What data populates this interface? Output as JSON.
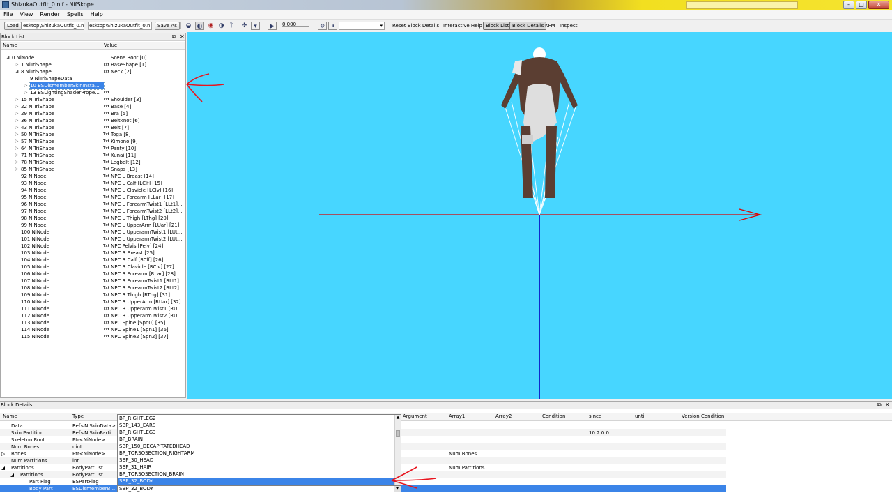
{
  "window": {
    "title": "ShizukaOutfit_0.nif - NifSkope",
    "min": "–",
    "max": "□",
    "close": "✕"
  },
  "menu": [
    "File",
    "View",
    "Render",
    "Spells",
    "Help"
  ],
  "toolbar": {
    "load": "Load",
    "load_path": "esktop\\ShizukaOutfit_0.nif",
    "save_path": "esktop\\ShizukaOutfit_0.nif",
    "save_as": "Save As",
    "time_value": "0.000",
    "reset_block_details": "Reset Block Details",
    "interactive_help": "Interactive Help",
    "block_list": "Block List",
    "block_details": "Block Details",
    "kfm": "KFM",
    "inspect": "Inspect"
  },
  "block_list": {
    "title": "Block List",
    "col_name": "Name",
    "col_value": "Value",
    "rows": [
      {
        "tw": "◢",
        "name": "0 NiNode",
        "txt": "",
        "value": "Scene Root [0]",
        "d": 0
      },
      {
        "tw": "▷",
        "name": "1 NiTriShape",
        "txt": "Txt",
        "value": "BaseShape [1]",
        "d": 1
      },
      {
        "tw": "◢",
        "name": "8 NiTriShape",
        "txt": "Txt",
        "value": "Neck [2]",
        "d": 1
      },
      {
        "tw": "",
        "name": "9 NiTriShapeData",
        "txt": "",
        "value": "",
        "d": 2
      },
      {
        "tw": "▷",
        "name": "10 BSDismemberSkinInsta...",
        "txt": "",
        "value": "",
        "d": 2,
        "sel": true
      },
      {
        "tw": "▷",
        "name": "13 BSLightingShaderPrope...",
        "txt": "Txt",
        "value": "",
        "d": 2
      },
      {
        "tw": "▷",
        "name": "15 NiTriShape",
        "txt": "Txt",
        "value": "Shoulder [3]",
        "d": 1
      },
      {
        "tw": "▷",
        "name": "22 NiTriShape",
        "txt": "Txt",
        "value": "Base [4]",
        "d": 1
      },
      {
        "tw": "▷",
        "name": "29 NiTriShape",
        "txt": "Txt",
        "value": "Bra [5]",
        "d": 1
      },
      {
        "tw": "▷",
        "name": "36 NiTriShape",
        "txt": "Txt",
        "value": "Beltknot [6]",
        "d": 1
      },
      {
        "tw": "▷",
        "name": "43 NiTriShape",
        "txt": "Txt",
        "value": "Belt [7]",
        "d": 1
      },
      {
        "tw": "▷",
        "name": "50 NiTriShape",
        "txt": "Txt",
        "value": "Toga [8]",
        "d": 1
      },
      {
        "tw": "▷",
        "name": "57 NiTriShape",
        "txt": "Txt",
        "value": "Kimono [9]",
        "d": 1
      },
      {
        "tw": "▷",
        "name": "64 NiTriShape",
        "txt": "Txt",
        "value": "Panty [10]",
        "d": 1
      },
      {
        "tw": "▷",
        "name": "71 NiTriShape",
        "txt": "Txt",
        "value": "Kunai [11]",
        "d": 1
      },
      {
        "tw": "▷",
        "name": "78 NiTriShape",
        "txt": "Txt",
        "value": "Legbelt [12]",
        "d": 1
      },
      {
        "tw": "▷",
        "name": "85 NiTriShape",
        "txt": "Txt",
        "value": "Snaps [13]",
        "d": 1
      },
      {
        "tw": "",
        "name": "92 NiNode",
        "txt": "Txt",
        "value": "NPC L Breast [14]",
        "d": 1
      },
      {
        "tw": "",
        "name": "93 NiNode",
        "txt": "Txt",
        "value": "NPC L Calf [LClf] [15]",
        "d": 1
      },
      {
        "tw": "",
        "name": "94 NiNode",
        "txt": "Txt",
        "value": "NPC L Clavicle [LClv] [16]",
        "d": 1
      },
      {
        "tw": "",
        "name": "95 NiNode",
        "txt": "Txt",
        "value": "NPC L Forearm [LLar] [17]",
        "d": 1
      },
      {
        "tw": "",
        "name": "96 NiNode",
        "txt": "Txt",
        "value": "NPC L ForearmTwist1 [LLt1]...",
        "d": 1
      },
      {
        "tw": "",
        "name": "97 NiNode",
        "txt": "Txt",
        "value": "NPC L ForearmTwist2 [LLt2]...",
        "d": 1
      },
      {
        "tw": "",
        "name": "98 NiNode",
        "txt": "Txt",
        "value": "NPC L Thigh [LThg] [20]",
        "d": 1
      },
      {
        "tw": "",
        "name": "99 NiNode",
        "txt": "Txt",
        "value": "NPC L UpperArm [LUar] [21]",
        "d": 1
      },
      {
        "tw": "",
        "name": "100 NiNode",
        "txt": "Txt",
        "value": "NPC L UpperarmTwist1 [LUt...",
        "d": 1
      },
      {
        "tw": "",
        "name": "101 NiNode",
        "txt": "Txt",
        "value": "NPC L UpperarmTwist2 [LUt...",
        "d": 1
      },
      {
        "tw": "",
        "name": "102 NiNode",
        "txt": "Txt",
        "value": "NPC Pelvis [Pelv] [24]",
        "d": 1
      },
      {
        "tw": "",
        "name": "103 NiNode",
        "txt": "Txt",
        "value": "NPC R Breast [25]",
        "d": 1
      },
      {
        "tw": "",
        "name": "104 NiNode",
        "txt": "Txt",
        "value": "NPC R Calf [RClf] [26]",
        "d": 1
      },
      {
        "tw": "",
        "name": "105 NiNode",
        "txt": "Txt",
        "value": "NPC R Clavicle [RClv] [27]",
        "d": 1
      },
      {
        "tw": "",
        "name": "106 NiNode",
        "txt": "Txt",
        "value": "NPC R Forearm [RLar] [28]",
        "d": 1
      },
      {
        "tw": "",
        "name": "107 NiNode",
        "txt": "Txt",
        "value": "NPC R ForearmTwist1 [RLt1]...",
        "d": 1
      },
      {
        "tw": "",
        "name": "108 NiNode",
        "txt": "Txt",
        "value": "NPC R ForearmTwist2 [RLt2]...",
        "d": 1
      },
      {
        "tw": "",
        "name": "109 NiNode",
        "txt": "Txt",
        "value": "NPC R Thigh [RThg] [31]",
        "d": 1
      },
      {
        "tw": "",
        "name": "110 NiNode",
        "txt": "Txt",
        "value": "NPC R UpperArm [RUar] [32]",
        "d": 1
      },
      {
        "tw": "",
        "name": "111 NiNode",
        "txt": "Txt",
        "value": "NPC R UpperarmTwist1 [RU...",
        "d": 1
      },
      {
        "tw": "",
        "name": "112 NiNode",
        "txt": "Txt",
        "value": "NPC R UpperarmTwist2 [RU...",
        "d": 1
      },
      {
        "tw": "",
        "name": "113 NiNode",
        "txt": "Txt",
        "value": "NPC Spine [Spn0] [35]",
        "d": 1
      },
      {
        "tw": "",
        "name": "114 NiNode",
        "txt": "Txt",
        "value": "NPC Spine1 [Spn1] [36]",
        "d": 1
      },
      {
        "tw": "",
        "name": "115 NiNode",
        "txt": "Txt",
        "value": "NPC Spine2 [Spn2] [37]",
        "d": 1
      }
    ]
  },
  "block_details": {
    "title": "Block Details",
    "columns": [
      "Name",
      "Type",
      "Argument",
      "Array1",
      "Array2",
      "Condition",
      "since",
      "until",
      "Version Condition"
    ],
    "rows": [
      {
        "tw": "",
        "name": "Data",
        "type": "Ref<NiSkinData>",
        "array1": "",
        "since": "",
        "d": 0
      },
      {
        "tw": "",
        "name": "Skin Partition",
        "type": "Ref<NiSkinParti...",
        "array1": "",
        "since": "10.2.0.0",
        "d": 0
      },
      {
        "tw": "",
        "name": "Skeleton Root",
        "type": "Ptr<NiNode>",
        "array1": "",
        "since": "",
        "d": 0
      },
      {
        "tw": "",
        "name": "Num Bones",
        "type": "uint",
        "array1": "",
        "since": "",
        "d": 0
      },
      {
        "tw": "▷",
        "name": "Bones",
        "type": "Ptr<NiNode>",
        "array1": "Num Bones",
        "since": "",
        "d": 0
      },
      {
        "tw": "",
        "name": "Num Partitions",
        "type": "int",
        "array1": "",
        "since": "",
        "d": 0
      },
      {
        "tw": "◢",
        "name": "Partitions",
        "type": "BodyPartList",
        "array1": "Num Partitions",
        "since": "",
        "d": 0
      },
      {
        "tw": "◢",
        "name": "Partitions",
        "type": "BodyPartList",
        "array1": "",
        "since": "",
        "d": 1
      },
      {
        "tw": "",
        "name": "Part Flag",
        "type": "BSPartFlag",
        "array1": "",
        "since": "",
        "d": 2
      },
      {
        "tw": "",
        "name": "Body Part",
        "type": "BSDismemberB...",
        "array1": "",
        "since": "",
        "d": 2,
        "sel": true
      }
    ],
    "dropdown_options": [
      "BP_RIGHTLEG2",
      "SBP_143_EARS",
      "BP_RIGHTLEG3",
      "BP_BRAIN",
      "SBP_150_DECAPITATEDHEAD",
      "BP_TORSOSECTION_RIGHTARM",
      "SBP_30_HEAD",
      "SBP_31_HAIR",
      "BP_TORSOSECTION_BRAIN",
      "SBP_32_BODY"
    ],
    "dropdown_highlight": 9,
    "dropdown_current": "SBP_32_BODY"
  },
  "colors": {
    "viewport": "#47d6ff",
    "selection": "#3b84e8",
    "annotation_arrow": "#e8141e"
  }
}
